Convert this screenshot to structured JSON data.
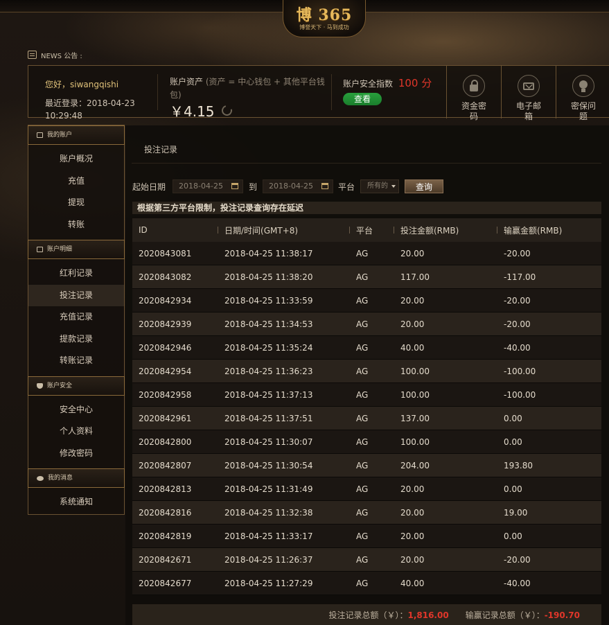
{
  "header": {
    "logo_main": "博 365",
    "logo_sub": "博誉天下 · 马到成功",
    "news_label": "NEWS 公告 :"
  },
  "account": {
    "greeting": "您好，siwangqishi",
    "last_login": "最近登录：2018-04-23 10:29:48",
    "assets_label": "账户资产",
    "assets_note": "(资产 = 中心钱包 + 其他平台钱包)",
    "balance": "￥4.15",
    "safety_label": "账户安全指数",
    "safety_score": "100 分",
    "view_button": "查看",
    "quick_links": [
      {
        "label": "资金密码",
        "icon": "lock-icon"
      },
      {
        "label": "电子邮箱",
        "icon": "mail-icon"
      },
      {
        "label": "密保问题",
        "icon": "bulb-icon"
      }
    ]
  },
  "sidebar": {
    "sections": [
      {
        "title": "我的账户",
        "items": [
          "账户概况",
          "充值",
          "提现",
          "转账"
        ]
      },
      {
        "title": "账户明细",
        "items": [
          "红利记录",
          "投注记录",
          "充值记录",
          "提款记录",
          "转账记录"
        ]
      },
      {
        "title": "账户安全",
        "items": [
          "安全中心",
          "个人资料",
          "修改密码"
        ]
      },
      {
        "title": "我的消息",
        "items": [
          "系统通知"
        ]
      }
    ],
    "active_item": "投注记录"
  },
  "main": {
    "title": "投注记录",
    "filter": {
      "start_label": "起始日期",
      "start_date": "2018-04-25",
      "to_label": "到",
      "end_date": "2018-04-25",
      "platform_label": "平台",
      "platform_value": "所有的",
      "query_button": "查询"
    },
    "notice": "根据第三方平台限制，投注记录查询存在延迟",
    "table": {
      "columns": [
        "ID",
        "日期/时间(GMT+8)",
        "平台",
        "投注金额(RMB)",
        "输赢金额(RMB)"
      ],
      "rows": [
        [
          "2020843081",
          "2018-04-25 11:38:17",
          "AG",
          "20.00",
          "-20.00"
        ],
        [
          "2020843082",
          "2018-04-25 11:38:20",
          "AG",
          "117.00",
          "-117.00"
        ],
        [
          "2020842934",
          "2018-04-25 11:33:59",
          "AG",
          "20.00",
          "-20.00"
        ],
        [
          "2020842939",
          "2018-04-25 11:34:53",
          "AG",
          "20.00",
          "-20.00"
        ],
        [
          "2020842946",
          "2018-04-25 11:35:24",
          "AG",
          "40.00",
          "-40.00"
        ],
        [
          "2020842954",
          "2018-04-25 11:36:23",
          "AG",
          "100.00",
          "-100.00"
        ],
        [
          "2020842958",
          "2018-04-25 11:37:13",
          "AG",
          "100.00",
          "-100.00"
        ],
        [
          "2020842961",
          "2018-04-25 11:37:51",
          "AG",
          "137.00",
          "0.00"
        ],
        [
          "2020842800",
          "2018-04-25 11:30:07",
          "AG",
          "100.00",
          "0.00"
        ],
        [
          "2020842807",
          "2018-04-25 11:30:54",
          "AG",
          "204.00",
          "193.80"
        ],
        [
          "2020842813",
          "2018-04-25 11:31:49",
          "AG",
          "20.00",
          "0.00"
        ],
        [
          "2020842816",
          "2018-04-25 11:32:38",
          "AG",
          "20.00",
          "19.00"
        ],
        [
          "2020842819",
          "2018-04-25 11:33:17",
          "AG",
          "20.00",
          "0.00"
        ],
        [
          "2020842671",
          "2018-04-25 11:26:37",
          "AG",
          "20.00",
          "-20.00"
        ],
        [
          "2020842677",
          "2018-04-25 11:27:29",
          "AG",
          "40.00",
          "-40.00"
        ]
      ]
    },
    "totals": {
      "bet_label": "投注记录总额（￥）：",
      "bet_value": "1,816.00",
      "win_label": "输赢记录总额（￥）：",
      "win_value": "-190.70"
    }
  }
}
